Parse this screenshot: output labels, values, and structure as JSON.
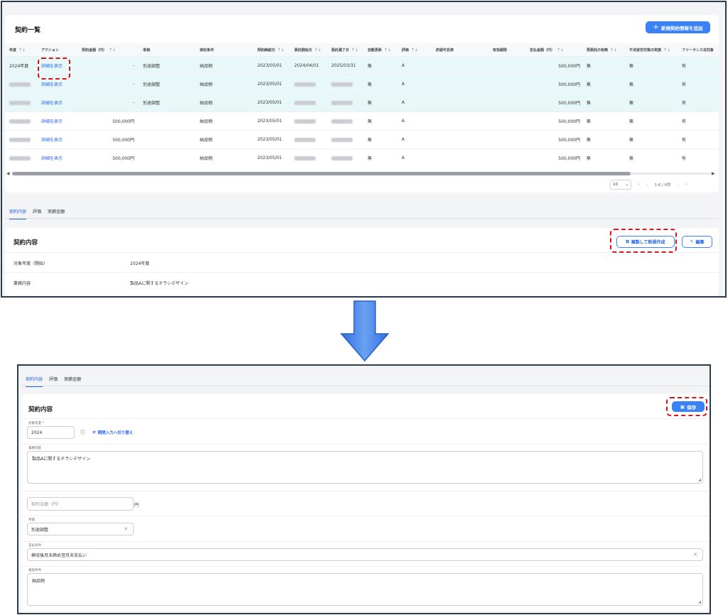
{
  "list": {
    "title": "契約一覧",
    "add_button": "新規契約情報を追加",
    "columns": [
      "年度",
      "アクション",
      "契約金額（円）",
      "単価",
      "検収条件",
      "契約締結日",
      "委託開始日",
      "委託満了日",
      "自動更新",
      "評価",
      "許認可名称",
      "有効期限",
      "支払金額（円）",
      "再委託の有無",
      "不法就労対策の実施",
      "フリーランス法対象"
    ],
    "sort_symbol": "↑↓",
    "rows": [
      {
        "year": "2024年度",
        "action": "詳細を表示",
        "amount": "-",
        "unit_price": "別途調整",
        "inspection": "納品物",
        "signed": "2023/05/01",
        "start": "2024/04/01",
        "end": "2025/03/31",
        "auto_renew": "無",
        "rating": "A",
        "license": "",
        "expiry": "",
        "payment": "500,000円",
        "subcontract": "無",
        "illegal": "無",
        "freelance": "有",
        "highlight": true
      },
      {
        "year": "",
        "action": "詳細を表示",
        "amount": "-",
        "unit_price": "別途調整",
        "inspection": "納品物",
        "signed": "2023/05/01",
        "start": "",
        "end": "",
        "auto_renew": "無",
        "rating": "A",
        "license": "",
        "expiry": "",
        "payment": "500,000円",
        "subcontract": "無",
        "illegal": "無",
        "freelance": "有",
        "highlight": true
      },
      {
        "year": "",
        "action": "詳細を表示",
        "amount": "-",
        "unit_price": "別途調整",
        "inspection": "納品物",
        "signed": "2023/05/01",
        "start": "",
        "end": "",
        "auto_renew": "無",
        "rating": "A",
        "license": "",
        "expiry": "",
        "payment": "500,000円",
        "subcontract": "無",
        "illegal": "無",
        "freelance": "有",
        "highlight": true
      },
      {
        "year": "",
        "action": "詳細を表示",
        "amount": "500,000円",
        "unit_price": "",
        "inspection": "納品物",
        "signed": "2023/05/01",
        "start": "",
        "end": "",
        "auto_renew": "無",
        "rating": "A",
        "license": "",
        "expiry": "",
        "payment": "500,000円",
        "subcontract": "無",
        "illegal": "無",
        "freelance": "有",
        "highlight": false
      },
      {
        "year": "",
        "action": "詳細を表示",
        "amount": "500,000円",
        "unit_price": "",
        "inspection": "納品物",
        "signed": "2023/05/01",
        "start": "",
        "end": "",
        "auto_renew": "無",
        "rating": "A",
        "license": "",
        "expiry": "",
        "payment": "500,000円",
        "subcontract": "無",
        "illegal": "無",
        "freelance": "有",
        "highlight": false
      },
      {
        "year": "",
        "action": "詳細を表示",
        "amount": "500,000円",
        "unit_price": "",
        "inspection": "納品物",
        "signed": "2023/05/01",
        "start": "",
        "end": "",
        "auto_renew": "無",
        "rating": "A",
        "license": "",
        "expiry": "",
        "payment": "500,000円",
        "subcontract": "無",
        "illegal": "無",
        "freelance": "有",
        "highlight": false
      }
    ],
    "page_size": "10",
    "page_range": "1-6 / 6件"
  },
  "tabs": [
    "契約内容",
    "評価",
    "実績金額"
  ],
  "detail": {
    "title": "契約内容",
    "copy_button": "複製して新規作成",
    "edit_button": "編集",
    "rows": [
      {
        "label": "対象年度（開始）",
        "value": "2024年度"
      },
      {
        "label": "業務内容",
        "value": "製品Aに関するチラシデザイン"
      }
    ]
  },
  "form": {
    "title": "契約内容",
    "save_button": "保存",
    "year_label": "対象年度",
    "year_value": "2024",
    "switch_link": "期間入力へ切り替え",
    "business_label": "業務内容",
    "business_value": "製品Aに関するチラシデザイン",
    "amount_placeholder": "契約金額（円）",
    "amount_unit": "円",
    "unit_price_label": "単価",
    "unit_price_value": "別途調整",
    "payment_label": "支払条件",
    "payment_value": "検収後月末締め翌月末支払い",
    "inspection_label": "検収条件",
    "inspection_value": "納品物"
  },
  "colors": {
    "accent": "#3b82f6",
    "highlight_row": "#e8f7f7",
    "annotation": "#d7151b",
    "arrow": "#3f7fe8"
  },
  "icons": [
    "plus-icon",
    "sort-icon",
    "chevron-down-icon",
    "first-page-icon",
    "prev-page-icon",
    "next-page-icon",
    "last-page-icon",
    "copy-icon",
    "pencil-icon",
    "save-icon",
    "info-icon",
    "swap-icon",
    "clear-icon",
    "down-arrow-icon"
  ]
}
